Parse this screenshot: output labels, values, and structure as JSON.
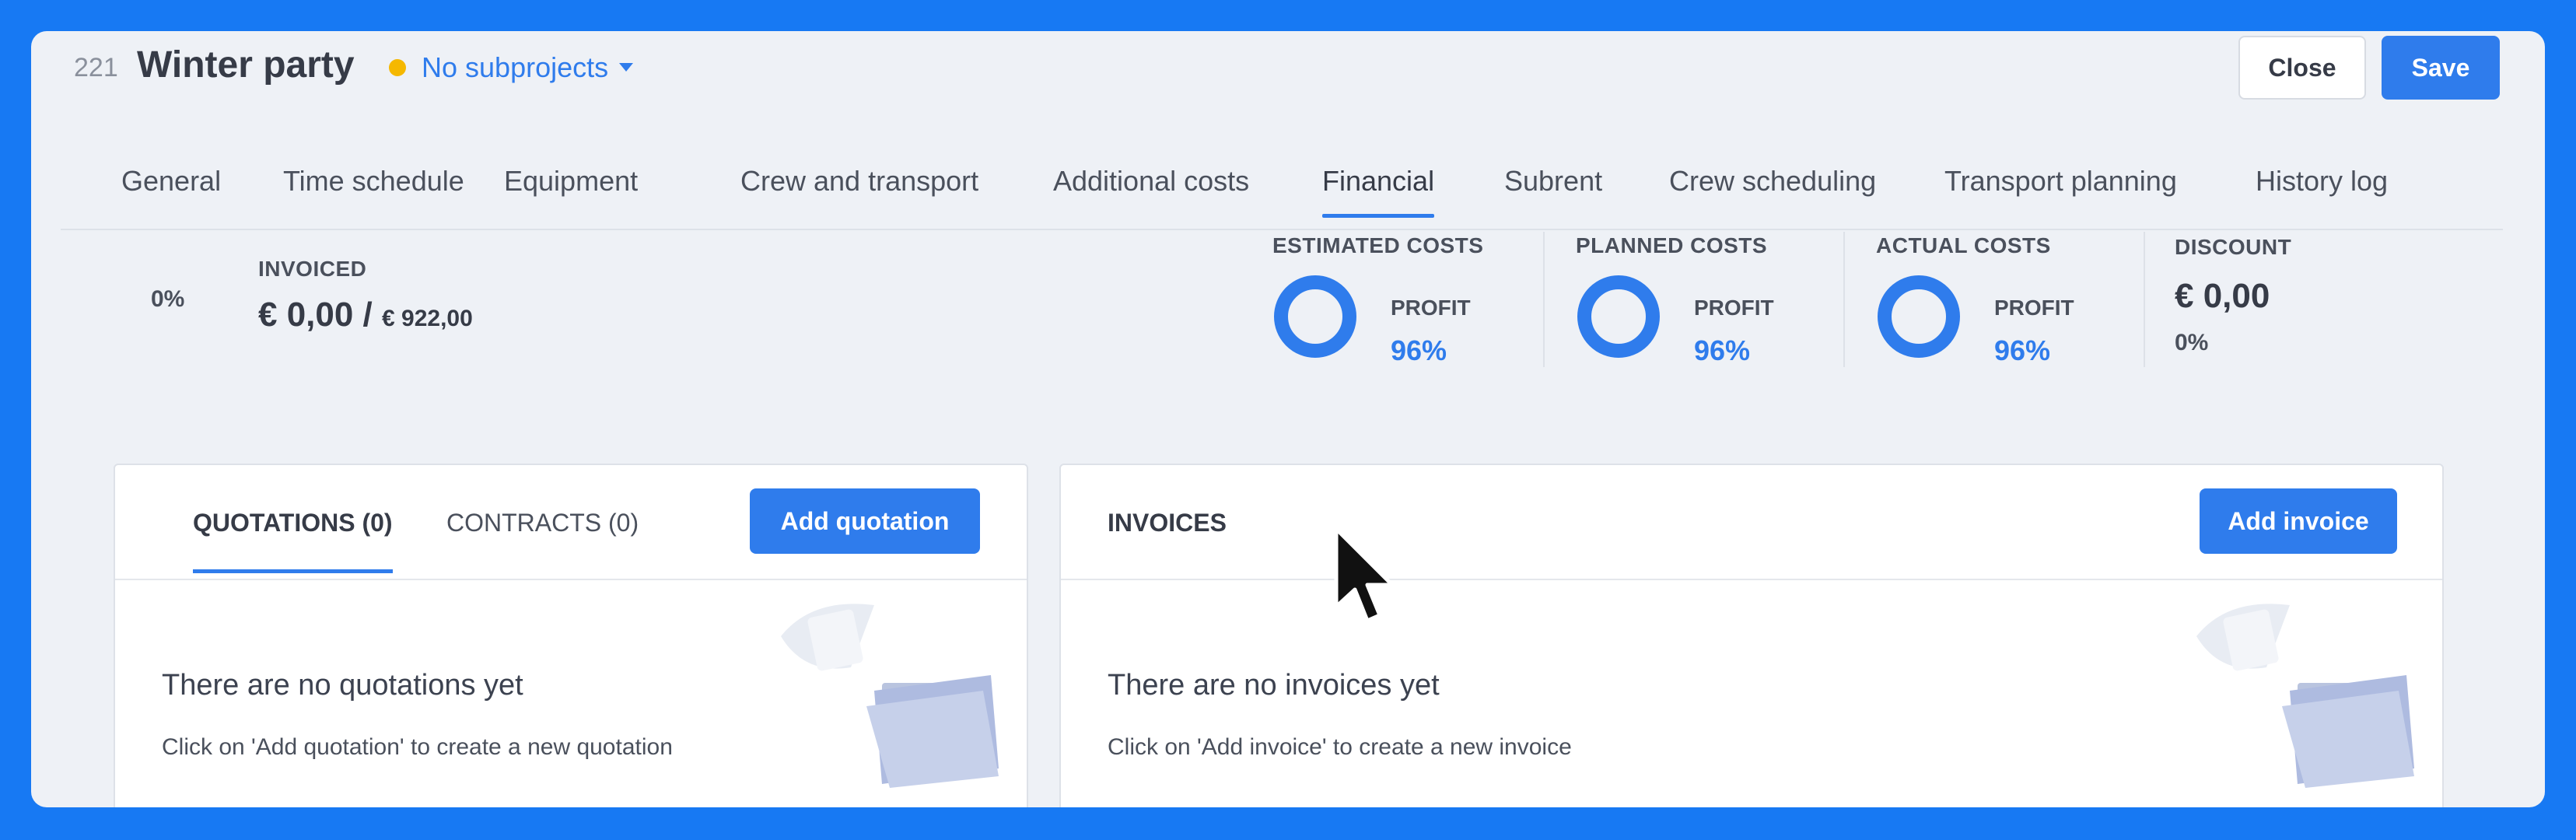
{
  "header": {
    "project_number": "221",
    "project_title": "Winter party",
    "subprojects_label": "No subprojects",
    "close_label": "Close",
    "save_label": "Save"
  },
  "tabs": [
    {
      "label": "General"
    },
    {
      "label": "Time schedule"
    },
    {
      "label": "Equipment"
    },
    {
      "label": "Crew and transport"
    },
    {
      "label": "Additional costs"
    },
    {
      "label": "Financial",
      "active": true
    },
    {
      "label": "Subrent"
    },
    {
      "label": "Crew scheduling"
    },
    {
      "label": "Transport planning"
    },
    {
      "label": "History log"
    }
  ],
  "summary": {
    "invoiced_percent": "0%",
    "invoiced_label": "INVOICED",
    "invoiced_amount": "€ 0,00 /",
    "invoiced_total": "€ 922,00",
    "metrics": [
      {
        "label": "ESTIMATED COSTS",
        "profit_label": "PROFIT",
        "profit_value": "96%"
      },
      {
        "label": "PLANNED COSTS",
        "profit_label": "PROFIT",
        "profit_value": "96%"
      },
      {
        "label": "ACTUAL COSTS",
        "profit_label": "PROFIT",
        "profit_value": "96%"
      }
    ],
    "discount_label": "DISCOUNT",
    "discount_amount": "€ 0,00",
    "discount_percent": "0%"
  },
  "quotations": {
    "tab_quotations": "QUOTATIONS (0)",
    "tab_contracts": "CONTRACTS (0)",
    "add_button": "Add quotation",
    "empty_title": "There are no quotations yet",
    "empty_subtitle": "Click on 'Add quotation' to create a new quotation"
  },
  "invoices": {
    "title": "INVOICES",
    "add_button": "Add invoice",
    "empty_title": "There are no invoices yet",
    "empty_subtitle": "Click on 'Add invoice' to create a new invoice"
  },
  "colors": {
    "accent": "#2f7cec",
    "background": "#1779f3",
    "status_dot": "#f5b800"
  }
}
